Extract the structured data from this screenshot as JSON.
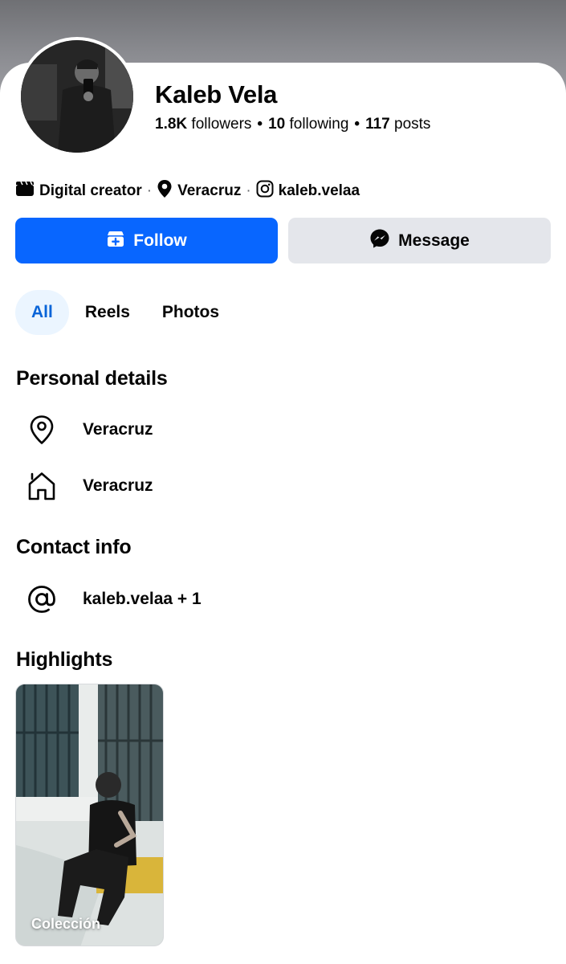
{
  "profile": {
    "name": "Kaleb Vela",
    "followers_count": "1.8K",
    "followers_label": "followers",
    "following_count": "10",
    "following_label": "following",
    "posts_count": "117",
    "posts_label": "posts",
    "separator": "•"
  },
  "meta": {
    "category": "Digital creator",
    "location": "Veracruz",
    "instagram": "kaleb.velaa",
    "separator": "·"
  },
  "actions": {
    "follow_label": "Follow",
    "message_label": "Message"
  },
  "tabs": [
    {
      "label": "All",
      "active": true
    },
    {
      "label": "Reels",
      "active": false
    },
    {
      "label": "Photos",
      "active": false
    }
  ],
  "personal_details": {
    "title": "Personal details",
    "current_city": "Veracruz",
    "hometown": "Veracruz"
  },
  "contact_info": {
    "title": "Contact info",
    "handle": "kaleb.velaa + 1"
  },
  "highlights": {
    "title": "Highlights",
    "items": [
      {
        "label": "Colección"
      }
    ]
  },
  "colors": {
    "accent": "#0866ff",
    "secondary_button": "#e4e6eb",
    "active_tab_bg": "#ebf5ff",
    "active_tab_text": "#0864d8"
  },
  "icons": {
    "category": "clapperboard-icon",
    "location": "location-pin-icon",
    "instagram": "instagram-icon",
    "follow": "add-friend-icon",
    "message": "messenger-icon",
    "city": "map-pin-outline-icon",
    "home": "home-icon",
    "contact": "at-sign-icon"
  }
}
